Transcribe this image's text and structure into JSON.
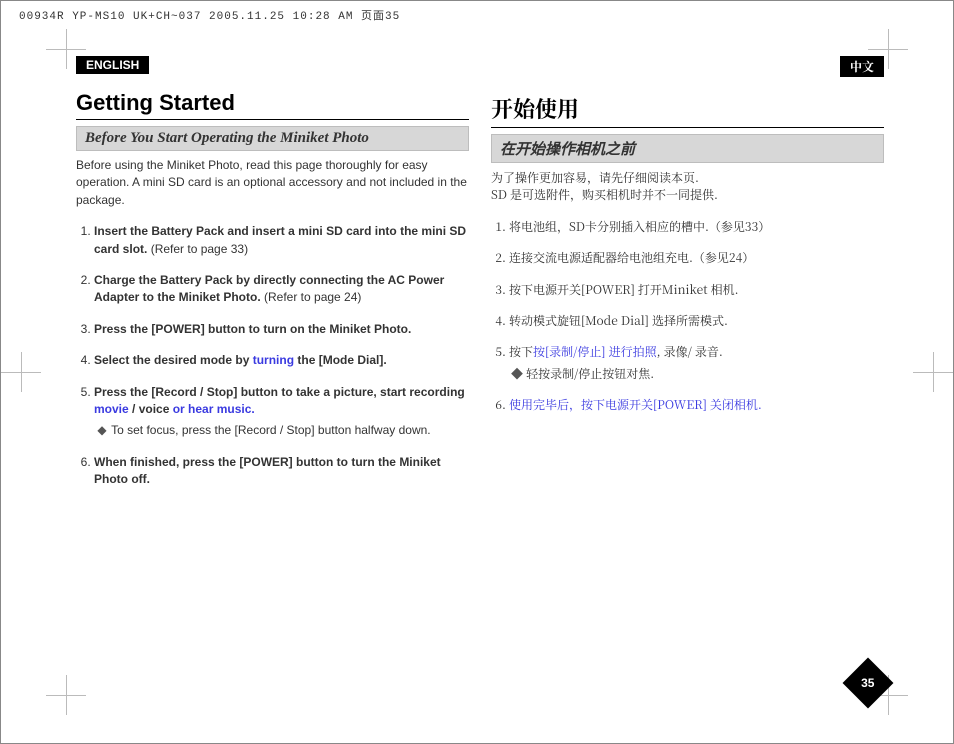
{
  "scanHeader": "00934R YP-MS10 UK+CH~037 2005.11.25 10:28 AM 页面35",
  "left": {
    "langTab": "ENGLISH",
    "title": "Getting Started",
    "subhead": "Before You Start Operating the Miniket Photo",
    "intro": "Before using the Miniket Photo, read this page thoroughly for easy operation. A mini SD card is an optional accessory and not included in the package.",
    "steps": [
      {
        "main": "Insert the Battery Pack and insert a mini SD card into the mini SD card slot.",
        "note": " (Refer to page 33)"
      },
      {
        "main": "Charge the Battery Pack by directly connecting the AC Power Adapter to the Miniket Photo.",
        "note": " (Refer to page 24)"
      },
      {
        "main": "Press the [POWER] button to turn on the Miniket Photo."
      },
      {
        "mainA": "Select the desired mode by ",
        "hl": "turning",
        "mainB": " the [Mode Dial]."
      },
      {
        "mainA": "Press the [Record / Stop] button to take a picture, start recording ",
        "hl": "movie",
        "mainB": " / voice ",
        "hl2": "or hear music.",
        "sub": "To set focus, press the [Record / Stop] button halfway down."
      },
      {
        "main": "When finished, press the [POWER] button to turn the Miniket Photo off."
      }
    ]
  },
  "right": {
    "langTab": "中文",
    "title": "开始使用",
    "subhead": "在开始操作相机之前",
    "introA": "为了操作更加容易，请先仔细阅读本页.",
    "introB": "SD 是可选附件，购买相机时并不一同提供.",
    "steps": [
      {
        "text": "将电池组，SD卡分别插入相应的槽中.（参见33）"
      },
      {
        "text": "连接交流电源适配器给电池组充电.（参见24）"
      },
      {
        "text": "按下电源开关[POWER] 打开Miniket 相机."
      },
      {
        "text": "转动模式旋钮[Mode Dial] 选择所需模式."
      },
      {
        "textA": "按下",
        "hlA": "按[录制/停止] 进行拍照",
        "textB": ", 录像/ 录音.",
        "sub": "轻按录制/停止按钮对焦."
      },
      {
        "hl": "使用完毕后，按下电源开关[POWER] 关闭相机."
      }
    ]
  },
  "pageNumber": "35"
}
